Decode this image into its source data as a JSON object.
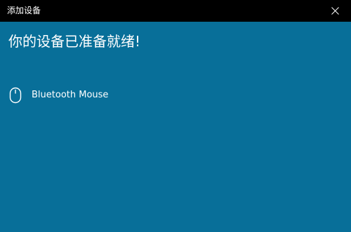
{
  "window": {
    "title": "添加设备"
  },
  "main": {
    "heading": "你的设备已准备就绪!",
    "devices": [
      {
        "name": "Bluetooth Mouse",
        "icon": "mouse-icon"
      }
    ]
  },
  "colors": {
    "titlebar": "#000000",
    "background": "#086f99",
    "text": "#ffffff"
  }
}
